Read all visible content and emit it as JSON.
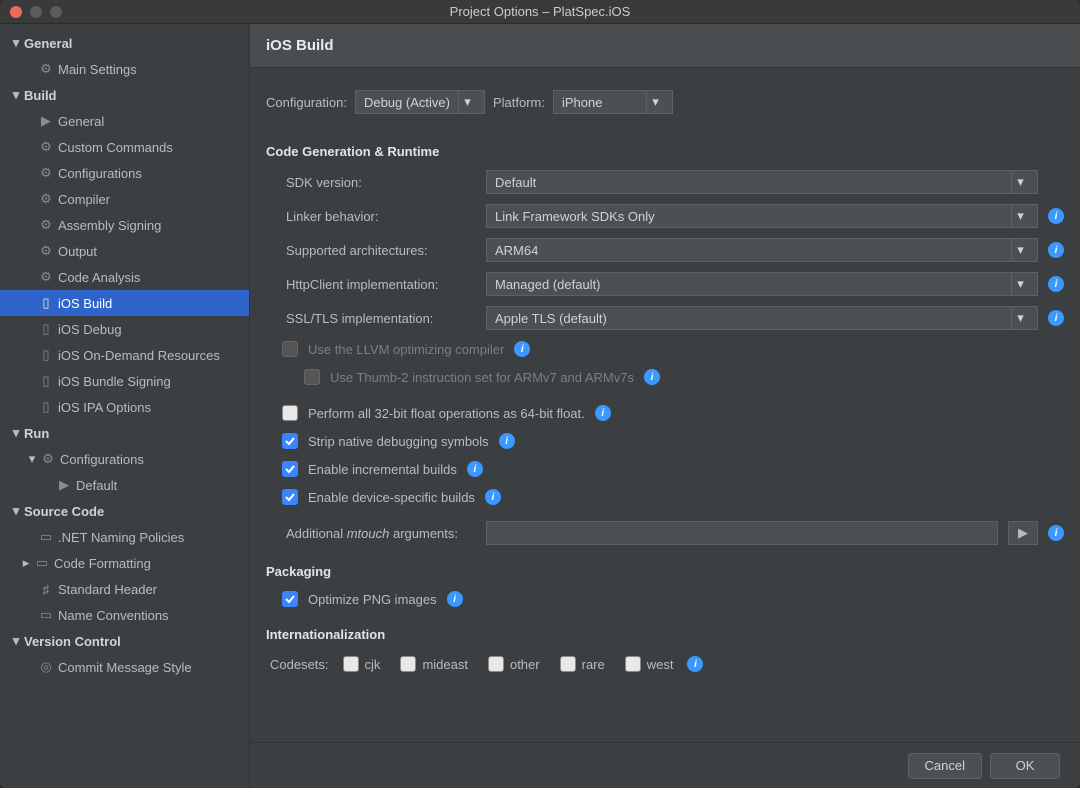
{
  "window": {
    "title": "Project Options – PlatSpec.iOS"
  },
  "traffic": {
    "close": "#ec6b5f",
    "min": "#5c5c5c",
    "max": "#5c5c5c"
  },
  "sidebar": {
    "general": {
      "label": "General",
      "items": [
        {
          "label": "Main Settings",
          "icon": "gear"
        }
      ]
    },
    "build": {
      "label": "Build",
      "items": [
        {
          "label": "General",
          "icon": "play"
        },
        {
          "label": "Custom Commands",
          "icon": "gear"
        },
        {
          "label": "Configurations",
          "icon": "gear"
        },
        {
          "label": "Compiler",
          "icon": "gear"
        },
        {
          "label": "Assembly Signing",
          "icon": "gear"
        },
        {
          "label": "Output",
          "icon": "gear"
        },
        {
          "label": "Code Analysis",
          "icon": "gear"
        },
        {
          "label": "iOS Build",
          "icon": "phone",
          "selected": true
        },
        {
          "label": "iOS Debug",
          "icon": "phone"
        },
        {
          "label": "iOS On-Demand Resources",
          "icon": "phone"
        },
        {
          "label": "iOS Bundle Signing",
          "icon": "phone"
        },
        {
          "label": "iOS IPA Options",
          "icon": "phone"
        }
      ]
    },
    "run": {
      "label": "Run",
      "configs": {
        "label": "Configurations",
        "icon": "gear"
      },
      "default": {
        "label": "Default",
        "icon": "play"
      }
    },
    "source": {
      "label": "Source Code",
      "items": [
        {
          "label": ".NET Naming Policies",
          "icon": "card"
        },
        {
          "label": "Code Formatting",
          "icon": "card",
          "expandable": true
        },
        {
          "label": "Standard Header",
          "icon": "hash"
        },
        {
          "label": "Name Conventions",
          "icon": "card"
        }
      ]
    },
    "vc": {
      "label": "Version Control",
      "items": [
        {
          "label": "Commit Message Style",
          "icon": "target"
        }
      ]
    }
  },
  "main": {
    "title": "iOS Build",
    "config": {
      "label": "Configuration:",
      "value": "Debug (Active)"
    },
    "platform": {
      "label": "Platform:",
      "value": "iPhone"
    },
    "codegen": {
      "title": "Code Generation & Runtime",
      "sdk": {
        "label": "SDK version:",
        "value": "Default"
      },
      "linker": {
        "label": "Linker behavior:",
        "value": "Link Framework SDKs Only"
      },
      "arch": {
        "label": "Supported architectures:",
        "value": "ARM64"
      },
      "http": {
        "label": "HttpClient implementation:",
        "value": "Managed (default)"
      },
      "ssl": {
        "label": "SSL/TLS implementation:",
        "value": "Apple TLS (default)"
      },
      "llvm": {
        "label": "Use the LLVM optimizing compiler",
        "checked": false,
        "enabled": false
      },
      "thumb": {
        "label": "Use Thumb-2 instruction set for ARMv7 and ARMv7s",
        "checked": false,
        "enabled": false
      },
      "float": {
        "label": "Perform all 32-bit float operations as 64-bit float.",
        "checked": false,
        "enabled": true
      },
      "strip": {
        "label": "Strip native debugging symbols",
        "checked": true,
        "enabled": true
      },
      "incr": {
        "label": "Enable incremental builds",
        "checked": true,
        "enabled": true
      },
      "devspec": {
        "label": "Enable device-specific builds",
        "checked": true,
        "enabled": true
      },
      "mtouch": {
        "prefix": "Additional ",
        "em": "mtouch",
        "suffix": " arguments:"
      }
    },
    "packaging": {
      "title": "Packaging",
      "png": {
        "label": "Optimize PNG images",
        "checked": true
      }
    },
    "i18n": {
      "title": "Internationalization",
      "codesets_label": "Codesets:",
      "sets": [
        {
          "label": "cjk"
        },
        {
          "label": "mideast"
        },
        {
          "label": "other"
        },
        {
          "label": "rare"
        },
        {
          "label": "west"
        }
      ]
    }
  },
  "footer": {
    "cancel": "Cancel",
    "ok": "OK"
  }
}
